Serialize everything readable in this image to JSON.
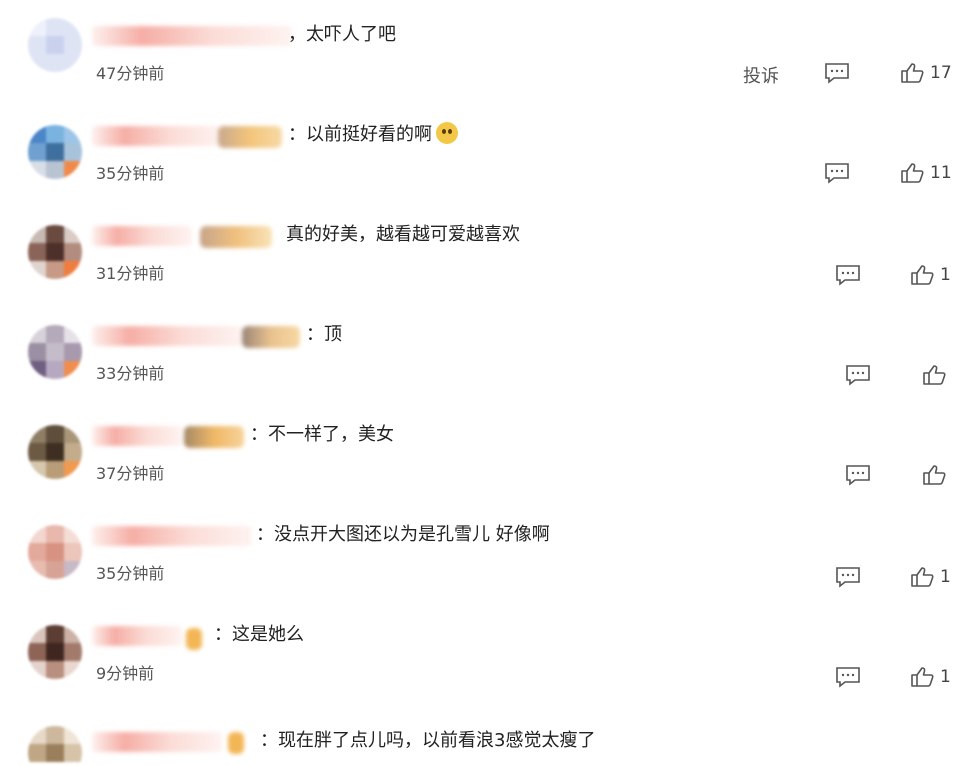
{
  "comments": [
    {
      "text": "，太吓人了吧",
      "time": "47分钟前",
      "report": "投诉",
      "likes": "17"
    },
    {
      "text": "：以前挺好看的啊",
      "time": "35分钟前",
      "likes": "11"
    },
    {
      "text": "真的好美，越看越可爱越喜欢",
      "time": "31分钟前",
      "likes": "1"
    },
    {
      "text": "：顶",
      "time": "33分钟前",
      "likes": ""
    },
    {
      "text": "：不一样了，美女",
      "time": "37分钟前",
      "likes": ""
    },
    {
      "text": "：没点开大图还以为是孔雪儿 好像啊",
      "time": "35分钟前",
      "likes": "1"
    },
    {
      "text": "：这是她么",
      "time": "9分钟前",
      "likes": "1"
    },
    {
      "text": "：现在胖了点儿吗，以前看浪3感觉太瘦了",
      "time": "",
      "likes": ""
    }
  ],
  "icons": {
    "reply": "comment-icon",
    "like": "thumbs-up-icon",
    "emoji": "doge-emoji-icon"
  }
}
